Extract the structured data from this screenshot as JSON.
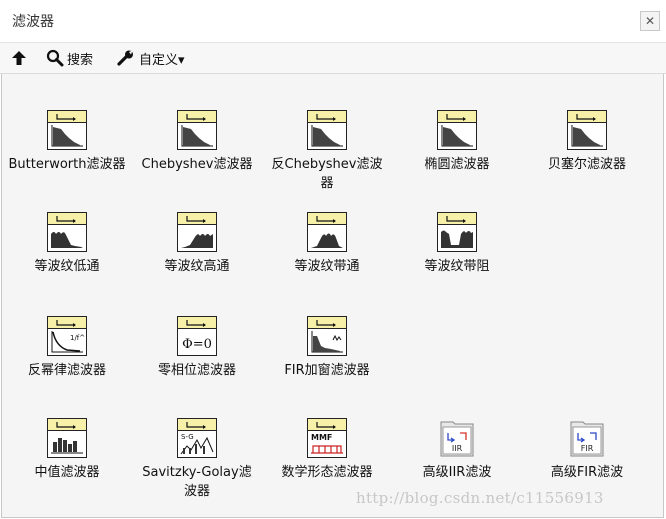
{
  "window": {
    "title": "滤波器",
    "close_glyph": "✕"
  },
  "toolbar": {
    "up_icon": "up-arrow-icon",
    "search_label": "搜索",
    "customize_label": "自定义▾"
  },
  "palette": {
    "rows": [
      [
        {
          "label": "Butterworth滤波器",
          "icon": "butterworth-filter-icon",
          "glyph": "lowpass"
        },
        {
          "label": "Chebyshev滤波器",
          "icon": "chebyshev-filter-icon",
          "glyph": "lowpass"
        },
        {
          "label": "反Chebyshev滤波器",
          "icon": "inverse-chebyshev-filter-icon",
          "glyph": "lowpass"
        },
        {
          "label": "椭圆滤波器",
          "icon": "elliptic-filter-icon",
          "glyph": "lowpass"
        },
        {
          "label": "贝塞尔滤波器",
          "icon": "bessel-filter-icon",
          "glyph": "lowpass"
        }
      ],
      [
        {
          "label": "等波纹低通",
          "icon": "equiripple-lowpass-icon",
          "glyph": "eqlow"
        },
        {
          "label": "等波纹高通",
          "icon": "equiripple-highpass-icon",
          "glyph": "eqhigh"
        },
        {
          "label": "等波纹带通",
          "icon": "equiripple-bandpass-icon",
          "glyph": "eqband"
        },
        {
          "label": "等波纹带阻",
          "icon": "equiripple-bandstop-icon",
          "glyph": "eqstop"
        }
      ],
      [
        {
          "label": "反幂律滤波器",
          "icon": "inverse-power-law-filter-icon",
          "glyph": "powerlaw",
          "text": "1/f^"
        },
        {
          "label": "零相位滤波器",
          "icon": "zero-phase-filter-icon",
          "glyph": "zerophase",
          "text": "Φ=0"
        },
        {
          "label": "FIR加窗滤波器",
          "icon": "fir-windowed-filter-icon",
          "glyph": "firwin"
        }
      ],
      [
        {
          "label": "中值滤波器",
          "icon": "median-filter-icon",
          "glyph": "median"
        },
        {
          "label": "Savitzky-Golay滤波器",
          "icon": "savitzky-golay-filter-icon",
          "glyph": "sg",
          "text": "S-G"
        },
        {
          "label": "数学形态滤波器",
          "icon": "morphological-filter-icon",
          "glyph": "mmf",
          "text": "MMF"
        },
        {
          "label": "高级IIR滤波",
          "icon": "advanced-iir-folder-icon",
          "glyph": "folder",
          "text": "IIR"
        },
        {
          "label": "高级FIR滤波",
          "icon": "advanced-fir-folder-icon",
          "glyph": "folder",
          "text": "FIR"
        }
      ]
    ]
  },
  "colors": {
    "icon_header": "#f6f0a8",
    "icon_border": "#222222",
    "folder_accent": "#2b49c8",
    "folder_accent_red": "#d6322b"
  },
  "watermark": "http://blog.csdn.net/c11556913"
}
